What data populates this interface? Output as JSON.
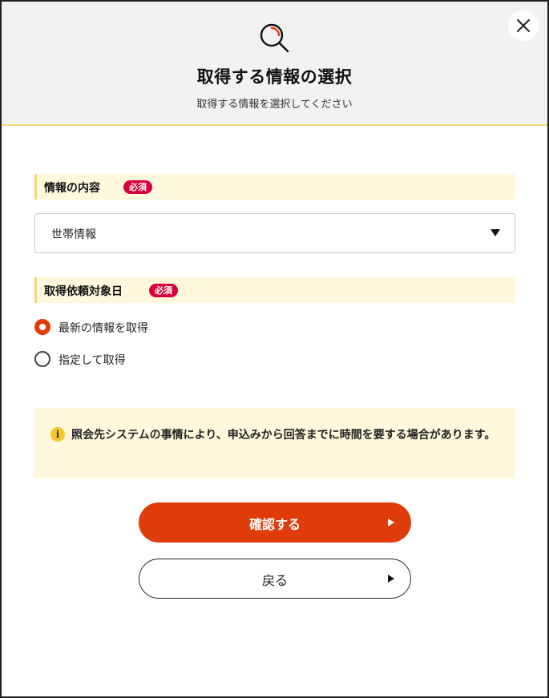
{
  "dialog": {
    "title": "取得する情報の選択",
    "subtitle": "取得する情報を選択してください",
    "header_icon": "search-icon",
    "close_icon": "close-icon"
  },
  "info_content": {
    "label": "情報の内容",
    "required_badge": "必須",
    "select": {
      "selected_value": "世帯情報",
      "arrow_icon": "triangle-down-icon"
    }
  },
  "request_date": {
    "label": "取得依頼対象日",
    "required_badge": "必須",
    "options": [
      {
        "label": "最新の情報を取得",
        "checked": true
      },
      {
        "label": "指定して取得",
        "checked": false
      }
    ]
  },
  "notice": {
    "icon": "info-icon",
    "icon_glyph": "i",
    "text": "照会先システムの事情により、申込みから回答までに時間を要する場合があります。"
  },
  "buttons": {
    "confirm_label": "確認する",
    "back_label": "戻る"
  },
  "colors": {
    "accent": "#e03c0a",
    "required_badge": "#d7003a",
    "label_background": "#fff8dc",
    "header_border": "#f5d76e",
    "header_background": "#f2f2f2"
  }
}
